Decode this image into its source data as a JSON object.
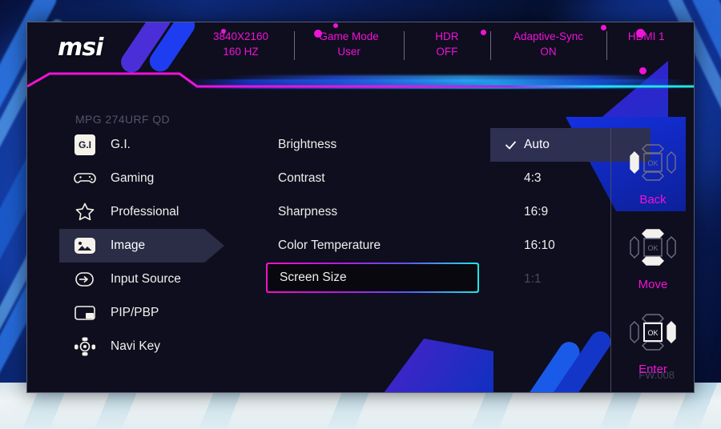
{
  "header": {
    "logo": "msi",
    "items": [
      {
        "name": "resolution",
        "line1": "3840X2160",
        "line2": "160 HZ"
      },
      {
        "name": "game-mode",
        "line1": "Game Mode",
        "line2": "User"
      },
      {
        "name": "hdr",
        "line1": "HDR",
        "line2": "OFF"
      },
      {
        "name": "adaptive-sync",
        "line1": "Adaptive-Sync",
        "line2": "ON"
      },
      {
        "name": "input",
        "line1": "HDMI 1",
        "line2": ""
      }
    ]
  },
  "model": "MPG 274URF QD",
  "sidebar": {
    "items": [
      {
        "label": "G.I.",
        "icon": "gi-icon",
        "selected": false
      },
      {
        "label": "Gaming",
        "icon": "gamepad-icon",
        "selected": false
      },
      {
        "label": "Professional",
        "icon": "star-icon",
        "selected": false
      },
      {
        "label": "Image",
        "icon": "image-icon",
        "selected": true
      },
      {
        "label": "Input Source",
        "icon": "input-source-icon",
        "selected": false
      },
      {
        "label": "PIP/PBP",
        "icon": "pip-pbp-icon",
        "selected": false
      },
      {
        "label": "Navi Key",
        "icon": "navi-key-icon",
        "selected": false
      }
    ],
    "scroll_indicator": "chevron-down-icon"
  },
  "settings": {
    "items": [
      {
        "label": "Brightness",
        "focused": false
      },
      {
        "label": "Contrast",
        "focused": false
      },
      {
        "label": "Sharpness",
        "focused": false
      },
      {
        "label": "Color Temperature",
        "focused": false
      },
      {
        "label": "Screen Size",
        "focused": true
      }
    ]
  },
  "values": {
    "options": [
      {
        "label": "Auto",
        "selected": true,
        "disabled": false
      },
      {
        "label": "4:3",
        "selected": false,
        "disabled": false
      },
      {
        "label": "16:9",
        "selected": false,
        "disabled": false
      },
      {
        "label": "16:10",
        "selected": false,
        "disabled": false
      },
      {
        "label": "1:1",
        "selected": false,
        "disabled": true
      }
    ],
    "check_icon": "check-icon"
  },
  "nav": {
    "buttons": [
      {
        "label": "Back",
        "icon": "navi-back-icon",
        "highlight": "left"
      },
      {
        "label": "Move",
        "icon": "navi-move-icon",
        "highlight": "vertical"
      },
      {
        "label": "Enter",
        "icon": "navi-enter-icon",
        "highlight": "ok-right"
      }
    ],
    "ok_text": "OK"
  },
  "firmware": "FW.008",
  "colors": {
    "magenta": "#f012d8",
    "cyan": "#22e4e4",
    "panel_bg": "#0e0e1e",
    "highlight": "#2b2c46",
    "value_highlight": "#2e3052",
    "dim_text": "#4a4a60"
  }
}
